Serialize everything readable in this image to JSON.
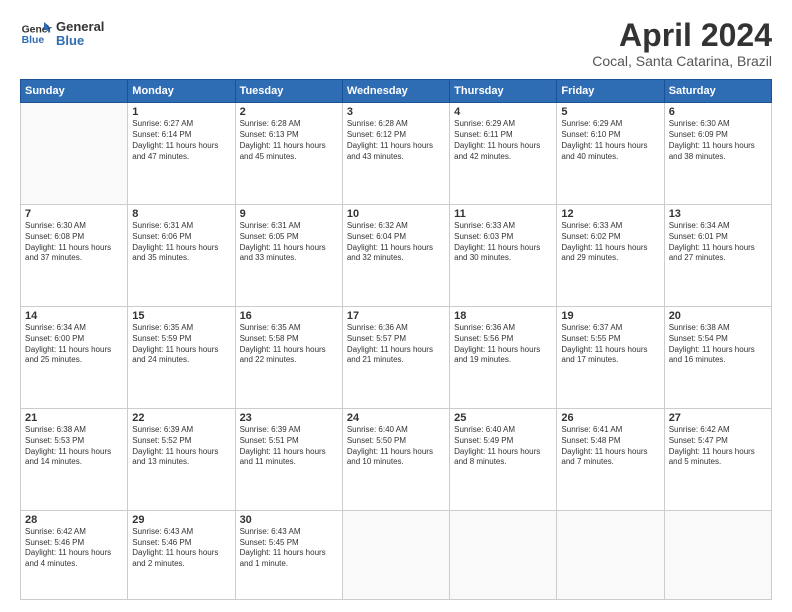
{
  "header": {
    "logo_line1": "General",
    "logo_line2": "Blue",
    "month": "April 2024",
    "location": "Cocal, Santa Catarina, Brazil"
  },
  "days_of_week": [
    "Sunday",
    "Monday",
    "Tuesday",
    "Wednesday",
    "Thursday",
    "Friday",
    "Saturday"
  ],
  "weeks": [
    [
      {
        "day": "",
        "sunrise": "",
        "sunset": "",
        "daylight": ""
      },
      {
        "day": "1",
        "sunrise": "6:27 AM",
        "sunset": "6:14 PM",
        "daylight": "11 hours and 47 minutes."
      },
      {
        "day": "2",
        "sunrise": "6:28 AM",
        "sunset": "6:13 PM",
        "daylight": "11 hours and 45 minutes."
      },
      {
        "day": "3",
        "sunrise": "6:28 AM",
        "sunset": "6:12 PM",
        "daylight": "11 hours and 43 minutes."
      },
      {
        "day": "4",
        "sunrise": "6:29 AM",
        "sunset": "6:11 PM",
        "daylight": "11 hours and 42 minutes."
      },
      {
        "day": "5",
        "sunrise": "6:29 AM",
        "sunset": "6:10 PM",
        "daylight": "11 hours and 40 minutes."
      },
      {
        "day": "6",
        "sunrise": "6:30 AM",
        "sunset": "6:09 PM",
        "daylight": "11 hours and 38 minutes."
      }
    ],
    [
      {
        "day": "7",
        "sunrise": "6:30 AM",
        "sunset": "6:08 PM",
        "daylight": "11 hours and 37 minutes."
      },
      {
        "day": "8",
        "sunrise": "6:31 AM",
        "sunset": "6:06 PM",
        "daylight": "11 hours and 35 minutes."
      },
      {
        "day": "9",
        "sunrise": "6:31 AM",
        "sunset": "6:05 PM",
        "daylight": "11 hours and 33 minutes."
      },
      {
        "day": "10",
        "sunrise": "6:32 AM",
        "sunset": "6:04 PM",
        "daylight": "11 hours and 32 minutes."
      },
      {
        "day": "11",
        "sunrise": "6:33 AM",
        "sunset": "6:03 PM",
        "daylight": "11 hours and 30 minutes."
      },
      {
        "day": "12",
        "sunrise": "6:33 AM",
        "sunset": "6:02 PM",
        "daylight": "11 hours and 29 minutes."
      },
      {
        "day": "13",
        "sunrise": "6:34 AM",
        "sunset": "6:01 PM",
        "daylight": "11 hours and 27 minutes."
      }
    ],
    [
      {
        "day": "14",
        "sunrise": "6:34 AM",
        "sunset": "6:00 PM",
        "daylight": "11 hours and 25 minutes."
      },
      {
        "day": "15",
        "sunrise": "6:35 AM",
        "sunset": "5:59 PM",
        "daylight": "11 hours and 24 minutes."
      },
      {
        "day": "16",
        "sunrise": "6:35 AM",
        "sunset": "5:58 PM",
        "daylight": "11 hours and 22 minutes."
      },
      {
        "day": "17",
        "sunrise": "6:36 AM",
        "sunset": "5:57 PM",
        "daylight": "11 hours and 21 minutes."
      },
      {
        "day": "18",
        "sunrise": "6:36 AM",
        "sunset": "5:56 PM",
        "daylight": "11 hours and 19 minutes."
      },
      {
        "day": "19",
        "sunrise": "6:37 AM",
        "sunset": "5:55 PM",
        "daylight": "11 hours and 17 minutes."
      },
      {
        "day": "20",
        "sunrise": "6:38 AM",
        "sunset": "5:54 PM",
        "daylight": "11 hours and 16 minutes."
      }
    ],
    [
      {
        "day": "21",
        "sunrise": "6:38 AM",
        "sunset": "5:53 PM",
        "daylight": "11 hours and 14 minutes."
      },
      {
        "day": "22",
        "sunrise": "6:39 AM",
        "sunset": "5:52 PM",
        "daylight": "11 hours and 13 minutes."
      },
      {
        "day": "23",
        "sunrise": "6:39 AM",
        "sunset": "5:51 PM",
        "daylight": "11 hours and 11 minutes."
      },
      {
        "day": "24",
        "sunrise": "6:40 AM",
        "sunset": "5:50 PM",
        "daylight": "11 hours and 10 minutes."
      },
      {
        "day": "25",
        "sunrise": "6:40 AM",
        "sunset": "5:49 PM",
        "daylight": "11 hours and 8 minutes."
      },
      {
        "day": "26",
        "sunrise": "6:41 AM",
        "sunset": "5:48 PM",
        "daylight": "11 hours and 7 minutes."
      },
      {
        "day": "27",
        "sunrise": "6:42 AM",
        "sunset": "5:47 PM",
        "daylight": "11 hours and 5 minutes."
      }
    ],
    [
      {
        "day": "28",
        "sunrise": "6:42 AM",
        "sunset": "5:46 PM",
        "daylight": "11 hours and 4 minutes."
      },
      {
        "day": "29",
        "sunrise": "6:43 AM",
        "sunset": "5:46 PM",
        "daylight": "11 hours and 2 minutes."
      },
      {
        "day": "30",
        "sunrise": "6:43 AM",
        "sunset": "5:45 PM",
        "daylight": "11 hours and 1 minute."
      },
      {
        "day": "",
        "sunrise": "",
        "sunset": "",
        "daylight": ""
      },
      {
        "day": "",
        "sunrise": "",
        "sunset": "",
        "daylight": ""
      },
      {
        "day": "",
        "sunrise": "",
        "sunset": "",
        "daylight": ""
      },
      {
        "day": "",
        "sunrise": "",
        "sunset": "",
        "daylight": ""
      }
    ]
  ]
}
